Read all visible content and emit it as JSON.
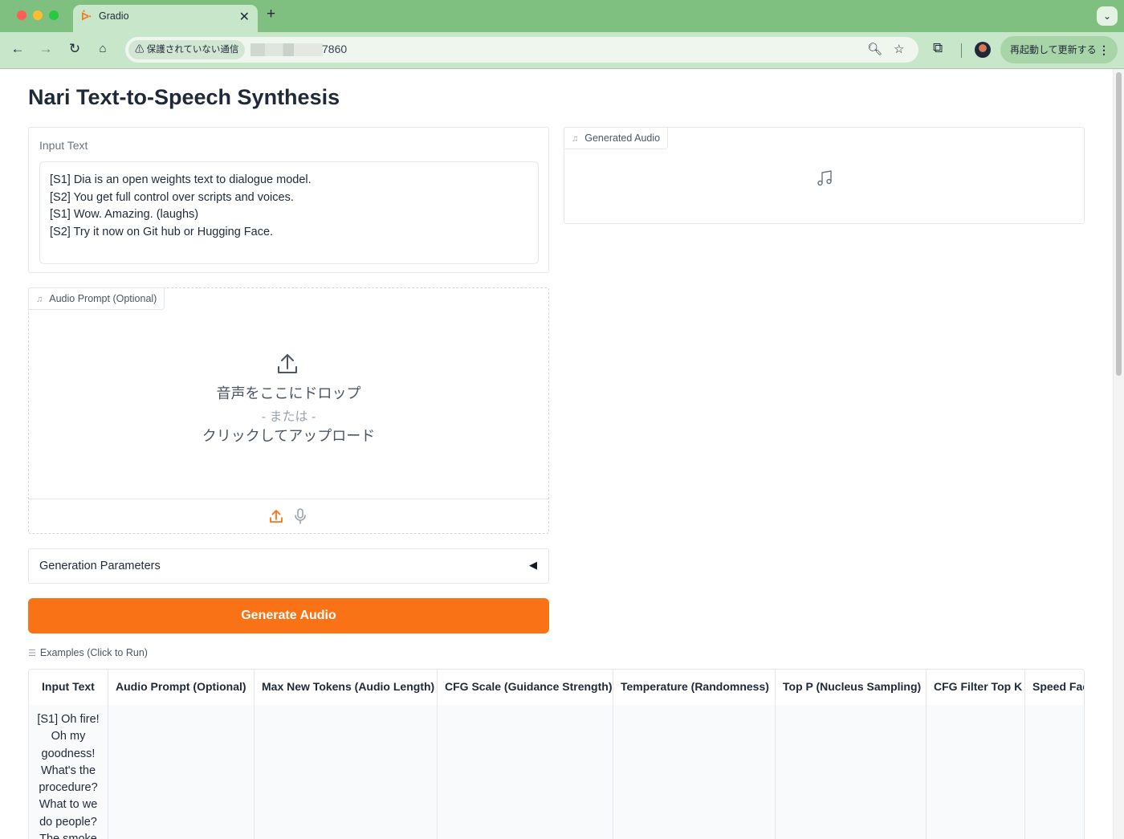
{
  "browser": {
    "tab_title": "Gradio",
    "tab_favicon": "gradio-icon",
    "security_label": "保護されていない通信",
    "url_suffix": "7860",
    "relaunch_label": "再起動して更新する"
  },
  "page": {
    "title": "Nari Text-to-Speech Synthesis"
  },
  "input_text": {
    "label": "Input Text",
    "lines": [
      "[S1] Dia is an open weights text to dialogue model.",
      "[S2] You get full control over scripts and voices.",
      "[S1] Wow. Amazing. (laughs)",
      "[S2] Try it now on Git hub or Hugging Face."
    ]
  },
  "audio_prompt": {
    "label": "Audio Prompt (Optional)",
    "drop_text": "音声をここにドロップ",
    "or_text": "- または -",
    "click_text": "クリックしてアップロード",
    "icons": [
      "upload-icon",
      "microphone-icon"
    ]
  },
  "generation_parameters": {
    "label": "Generation Parameters",
    "collapsed": true
  },
  "generate_button": {
    "label": "Generate Audio",
    "color": "#f97316"
  },
  "generated_audio": {
    "label": "Generated Audio",
    "icon": "music-icon"
  },
  "examples": {
    "label": "Examples (Click to Run)",
    "columns": [
      "Input Text",
      "Audio Prompt (Optional)",
      "Max New Tokens (Audio Length)",
      "CFG Scale (Guidance Strength)",
      "Temperature (Randomness)",
      "Top P (Nucleus Sampling)",
      "CFG Filter Top K",
      "Speed Factor"
    ],
    "first_row_text_lines": [
      "[S1] Oh fire!",
      "Oh my",
      "goodness!",
      "What's the",
      "procedure?",
      "What to we",
      "do people?",
      "The smoke"
    ]
  },
  "colors": {
    "accent": "#f97316",
    "chrome": "#7fbf7f",
    "toolbar": "#c8e6c9"
  }
}
